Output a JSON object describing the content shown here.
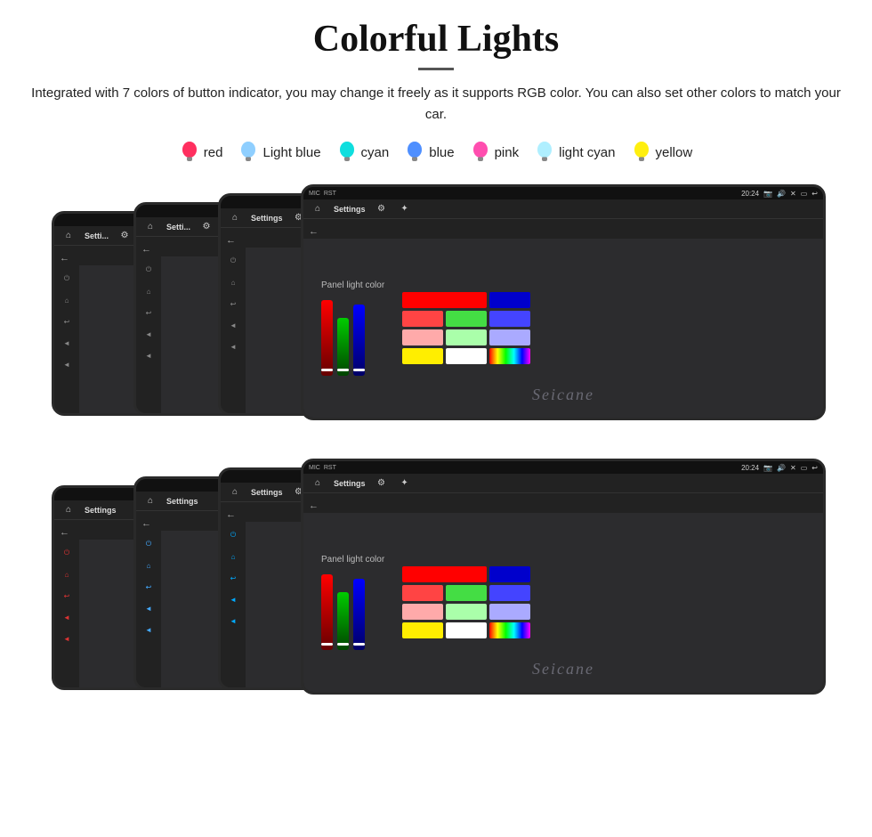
{
  "header": {
    "title": "Colorful Lights",
    "divider": true,
    "description": "Integrated with 7 colors of button indicator, you may change it freely as it supports RGB color. You can also set other colors to match your car."
  },
  "colors": [
    {
      "name": "red",
      "hex": "#ff2255",
      "bulb_color": "#ff2255",
      "glow": "#ff6688"
    },
    {
      "name": "Light blue",
      "hex": "#88ccff",
      "bulb_color": "#88ccff",
      "glow": "#aaddff"
    },
    {
      "name": "cyan",
      "hex": "#00dddd",
      "bulb_color": "#00dddd",
      "glow": "#44eeff"
    },
    {
      "name": "blue",
      "hex": "#4488ff",
      "bulb_color": "#4488ff",
      "glow": "#6699ff"
    },
    {
      "name": "pink",
      "hex": "#ff44aa",
      "bulb_color": "#ff44aa",
      "glow": "#ff88cc"
    },
    {
      "name": "light cyan",
      "hex": "#aaeeff",
      "bulb_color": "#aaeeff",
      "glow": "#ccffff"
    },
    {
      "name": "yellow",
      "hex": "#ffee00",
      "bulb_color": "#ffee00",
      "glow": "#ffff66"
    }
  ],
  "device": {
    "status_time": "20:24",
    "nav_title": "Settings",
    "panel_label": "Panel light color"
  },
  "color_grid_top": [
    "#ff0000",
    "#00cc00",
    "#0000ff",
    "#ff4444",
    "#44dd44",
    "#4444ff",
    "#ffaaaa",
    "#aaffaa",
    "#aaaaff",
    "#ffff44",
    "#ffffff",
    "#8844ff",
    "#ffee00",
    "#ffffff",
    "#ff44ff"
  ],
  "color_grid_bottom": [
    "#ff0000",
    "#00cc00",
    "#0000ff",
    "#ff4444",
    "#44dd44",
    "#4444ff",
    "#ffaaaa",
    "#aaffaa",
    "#aaaaff",
    "#ffff44",
    "#ffffff",
    "#8844ff",
    "#ffee00",
    "#ffffff",
    "#ff44ff"
  ],
  "watermark": "Seicane"
}
